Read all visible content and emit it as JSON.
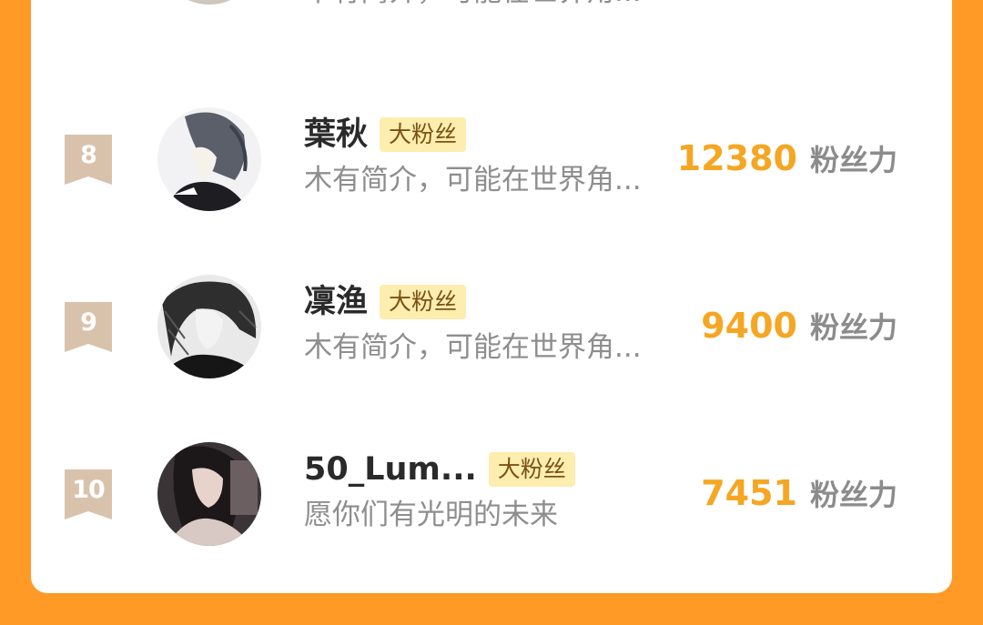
{
  "colors": {
    "page_background": "#ff9a26",
    "card_background": "#ffffff",
    "power_value": "#f5a623",
    "badge_background": "#fdedae",
    "rank_ribbon": "#d9c2ac"
  },
  "partial_row": {
    "bio": "木有简介，可能在世界角..."
  },
  "rows": [
    {
      "rank": "8",
      "name": "葉秋",
      "badge": "大粉丝",
      "bio": "木有简介，可能在世界角...",
      "power_value": "12380",
      "power_label": "粉丝力"
    },
    {
      "rank": "9",
      "name": "凜渔",
      "badge": "大粉丝",
      "bio": "木有简介，可能在世界角...",
      "power_value": "9400",
      "power_label": "粉丝力"
    },
    {
      "rank": "10",
      "name": "50_Lum...",
      "badge": "大粉丝",
      "bio": "愿你们有光明的未来",
      "power_value": "7451",
      "power_label": "粉丝力"
    }
  ]
}
